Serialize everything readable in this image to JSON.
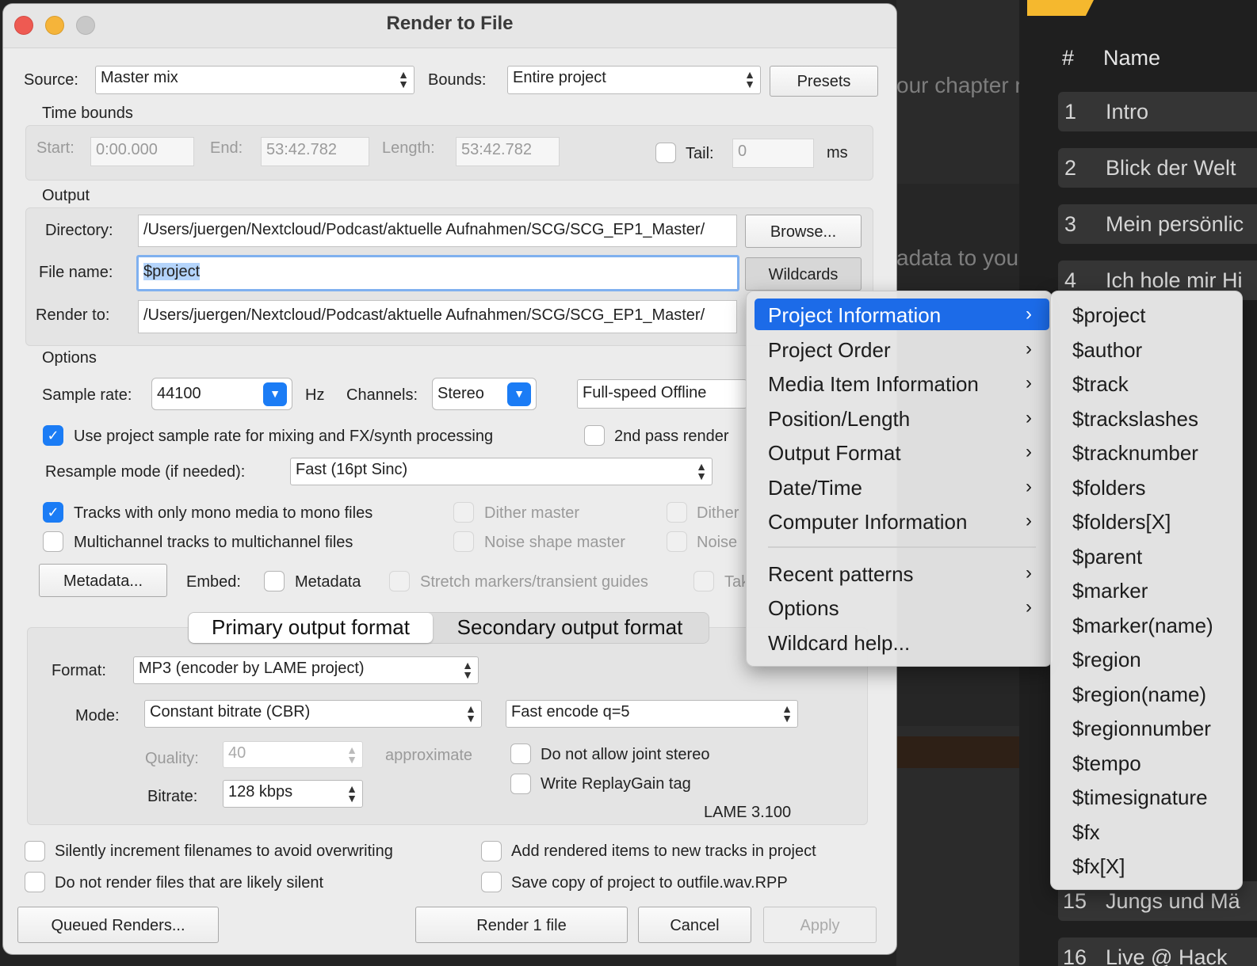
{
  "background": {
    "ghost_text_1": "our chapter n",
    "ghost_text_2": "adata to you",
    "columns": {
      "num": "#",
      "name": "Name"
    },
    "chapters": [
      {
        "num": "1",
        "name": "Intro"
      },
      {
        "num": "2",
        "name": "Blick der Welt"
      },
      {
        "num": "3",
        "name": "Mein persönlic"
      },
      {
        "num": "4",
        "name": "Ich hole mir Hi"
      },
      {
        "num": "15",
        "name": "Jungs und Mä"
      },
      {
        "num": "16",
        "name": "Live @ Hack"
      }
    ]
  },
  "dialog": {
    "title": "Render to File",
    "source_label": "Source:",
    "source_value": "Master mix",
    "bounds_label": "Bounds:",
    "bounds_value": "Entire project",
    "presets_button": "Presets",
    "time_bounds": {
      "heading": "Time bounds",
      "start_label": "Start:",
      "start_value": "0:00.000",
      "end_label": "End:",
      "end_value": "53:42.782",
      "length_label": "Length:",
      "length_value": "53:42.782",
      "tail_label": "Tail:",
      "tail_value": "0",
      "tail_unit": "ms"
    },
    "output": {
      "heading": "Output",
      "directory_label": "Directory:",
      "directory_value": "/Users/juergen/Nextcloud/Podcast/aktuelle Aufnahmen/SCG/SCG_EP1_Master/",
      "browse_button": "Browse...",
      "filename_label": "File name:",
      "filename_value": "$project",
      "wildcards_button": "Wildcards",
      "render_to_label": "Render to:",
      "render_to_value": "/Users/juergen/Nextcloud/Podcast/aktuelle Aufnahmen/SCG/SCG_EP1_Master/"
    },
    "options": {
      "heading": "Options",
      "sample_rate_label": "Sample rate:",
      "sample_rate_value": "44100",
      "hz": "Hz",
      "channels_label": "Channels:",
      "channels_value": "Stereo",
      "speed_value": "Full-speed Offline",
      "use_project_rate": "Use project sample rate for mixing and FX/synth processing",
      "second_pass": "2nd pass render",
      "resample_label": "Resample mode (if needed):",
      "resample_value": "Fast (16pt Sinc)",
      "mono_tracks": "Tracks with only mono media to mono files",
      "dither_master": "Dither master",
      "dither_stems": "Dither",
      "multichannel": "Multichannel tracks to multichannel files",
      "noise_shape_master": "Noise shape master",
      "noise_shape_stems": "Noise",
      "metadata_button": "Metadata...",
      "embed_label": "Embed:",
      "embed_metadata": "Metadata",
      "embed_stretch": "Stretch markers/transient guides",
      "embed_take": "Tak"
    },
    "format": {
      "tab_primary": "Primary output format",
      "tab_secondary": "Secondary output format",
      "format_label": "Format:",
      "format_value": "MP3 (encoder by LAME project)",
      "mode_label": "Mode:",
      "mode_value": "Constant bitrate  (CBR)",
      "encode_value": "Fast encode q=5",
      "quality_label": "Quality:",
      "quality_value": "40",
      "approximate": "approximate",
      "bitrate_label": "Bitrate:",
      "bitrate_value": "128 kbps",
      "no_joint_stereo": "Do not allow joint stereo",
      "replaygain": "Write ReplayGain tag",
      "lame_version": "LAME 3.100"
    },
    "bottom": {
      "silently_increment": "Silently increment filenames to avoid overwriting",
      "add_rendered": "Add rendered items to new tracks in project",
      "no_silent": "Do not render files that are likely silent",
      "save_copy": "Save copy of project to outfile.wav.RPP",
      "queued_button": "Queued Renders...",
      "render_button": "Render 1 file",
      "cancel_button": "Cancel",
      "apply_button": "Apply"
    }
  },
  "wildcard_menu": {
    "items": [
      {
        "label": "Project Information"
      },
      {
        "label": "Project Order"
      },
      {
        "label": "Media Item Information"
      },
      {
        "label": "Position/Length"
      },
      {
        "label": "Output Format"
      },
      {
        "label": "Date/Time"
      },
      {
        "label": "Computer Information"
      },
      {
        "label": "Recent patterns"
      },
      {
        "label": "Options"
      },
      {
        "label": "Wildcard help..."
      }
    ],
    "submenu": [
      "$project",
      "$author",
      "$track",
      "$trackslashes",
      "$tracknumber",
      "$folders",
      "$folders[X]",
      "$parent",
      "$marker",
      "$marker(name)",
      "$region",
      "$region(name)",
      "$regionnumber",
      "$tempo",
      "$timesignature",
      "$fx",
      "$fx[X]"
    ]
  },
  "colors": {
    "accent": "#1b7cf5",
    "menu_highlight": "#1c6be8",
    "traffic_close": "#ee5a52",
    "traffic_min": "#f5b43a",
    "traffic_max": "#c8c8c8",
    "chapter_tab": "#f5b82e"
  }
}
